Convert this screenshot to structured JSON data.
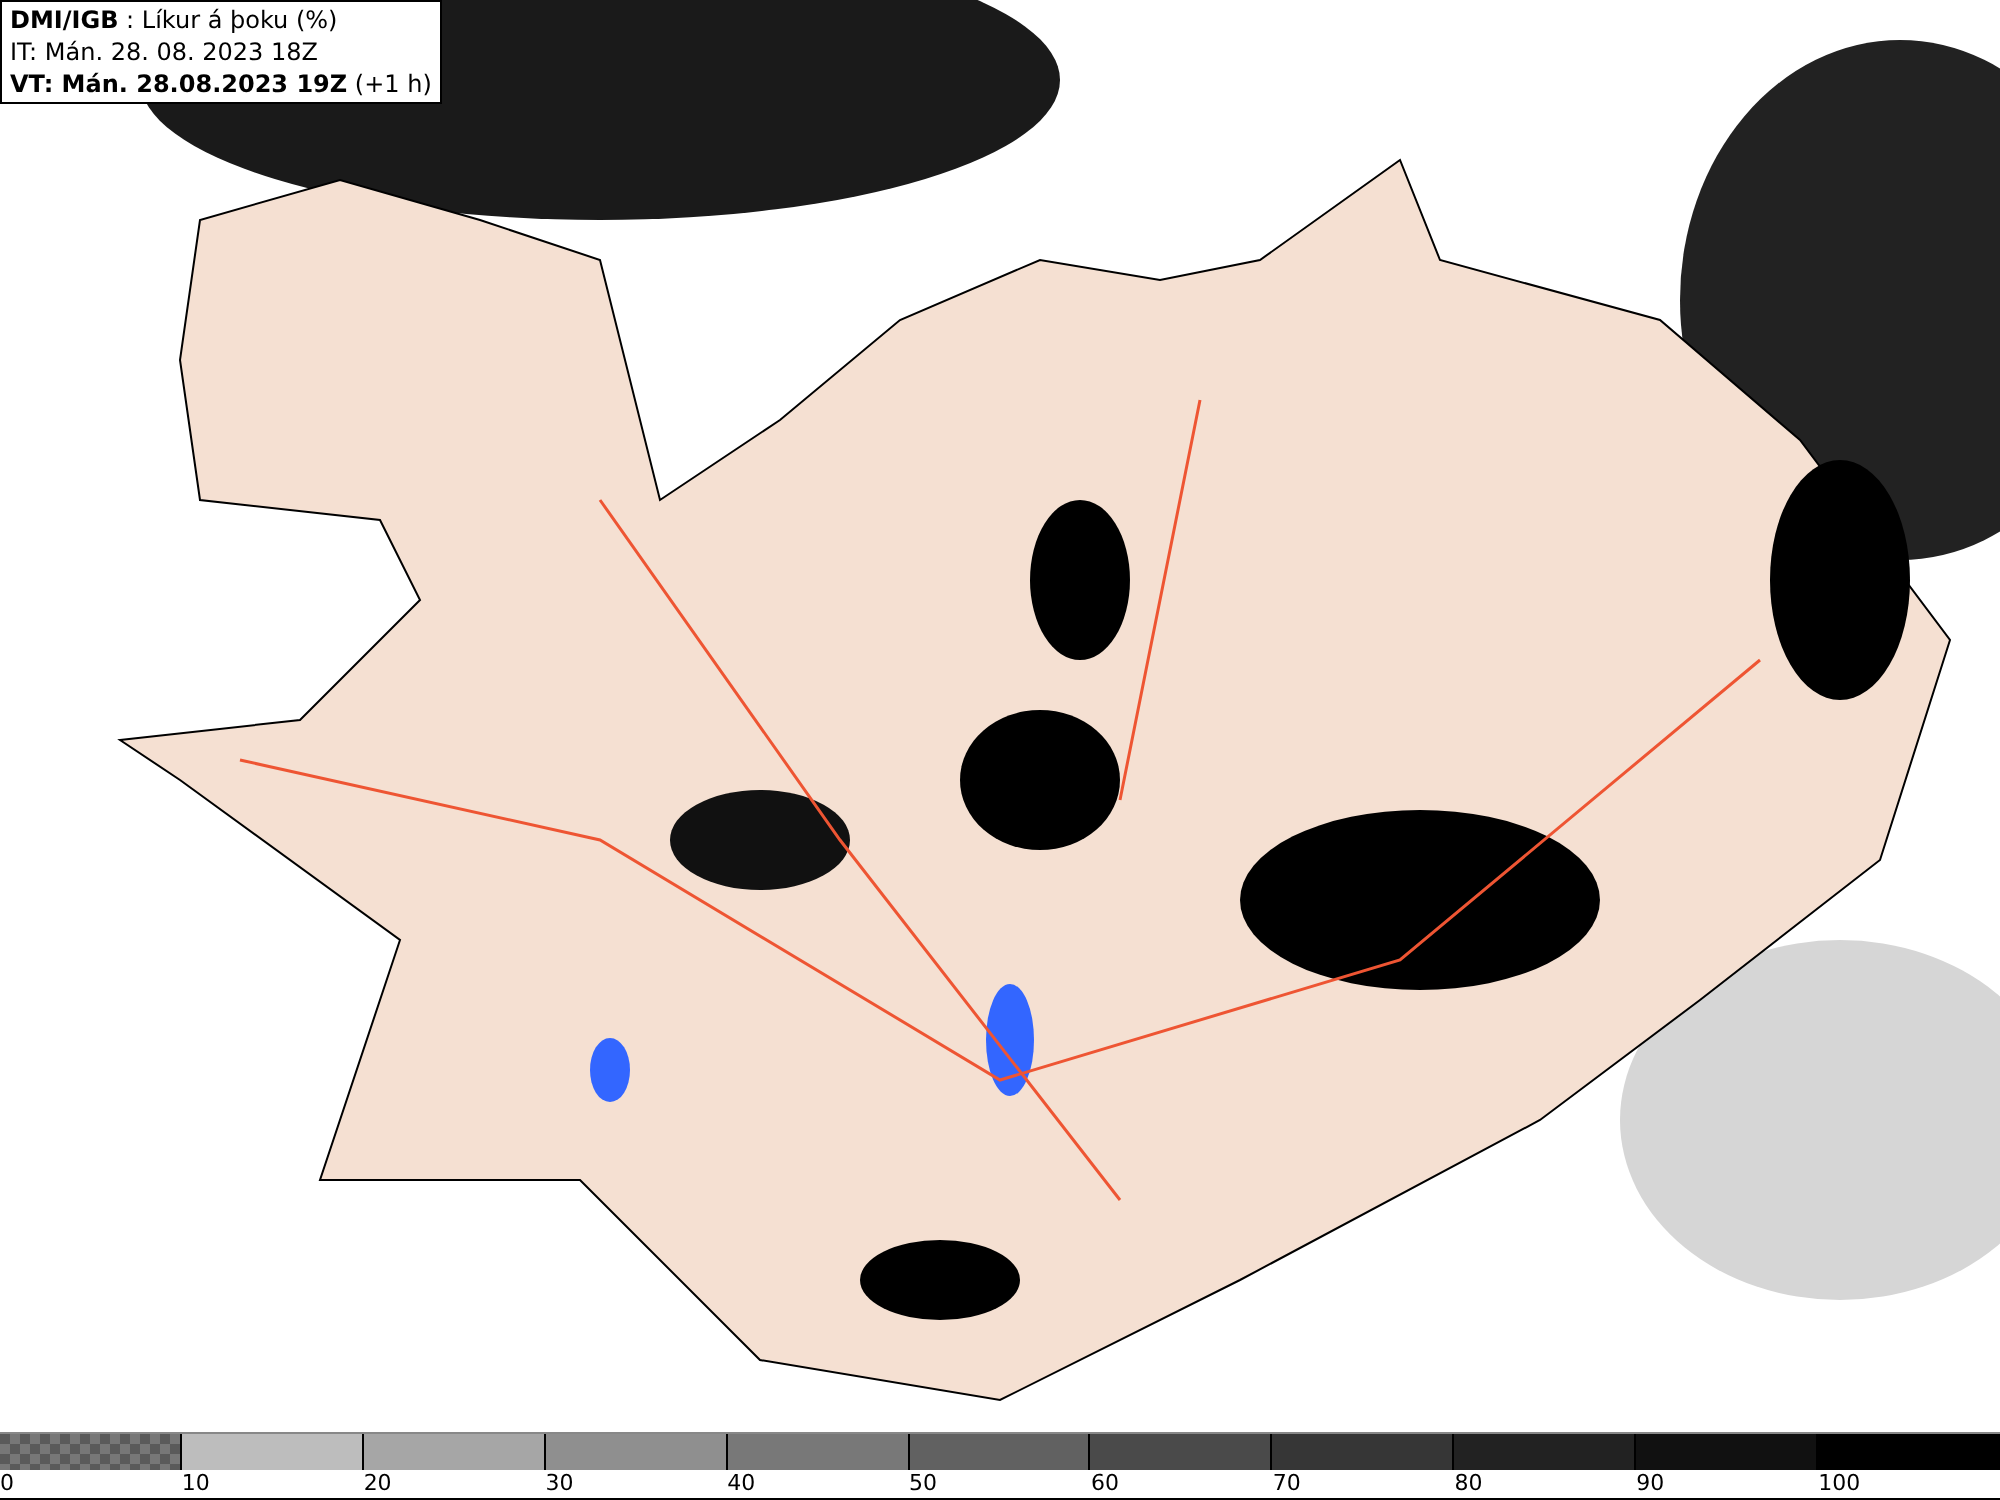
{
  "header": {
    "lines": [
      "**DMI/IGB** : Líkur á þoku (%)",
      "IT: Mán. 28. 08. 2023 18Z",
      "**VT: Mán. 28.08.2023 19Z** (+1 h)"
    ]
  },
  "legend": {
    "segments": [
      {
        "kind": "checker",
        "label": "0"
      },
      {
        "kind": "solid",
        "color": "#bdbdbd",
        "label": "10"
      },
      {
        "kind": "solid",
        "color": "#a6a6a6",
        "label": "20"
      },
      {
        "kind": "solid",
        "color": "#8f8f8f",
        "label": "30"
      },
      {
        "kind": "solid",
        "color": "#787878",
        "label": "40"
      },
      {
        "kind": "solid",
        "color": "#616161",
        "label": "50"
      },
      {
        "kind": "solid",
        "color": "#4a4a4a",
        "label": "60"
      },
      {
        "kind": "solid",
        "color": "#363636",
        "label": "70"
      },
      {
        "kind": "solid",
        "color": "#222222",
        "label": "80"
      },
      {
        "kind": "solid",
        "color": "#111111",
        "label": "90"
      },
      {
        "kind": "solid",
        "color": "#000000",
        "label": "100"
      }
    ]
  }
}
